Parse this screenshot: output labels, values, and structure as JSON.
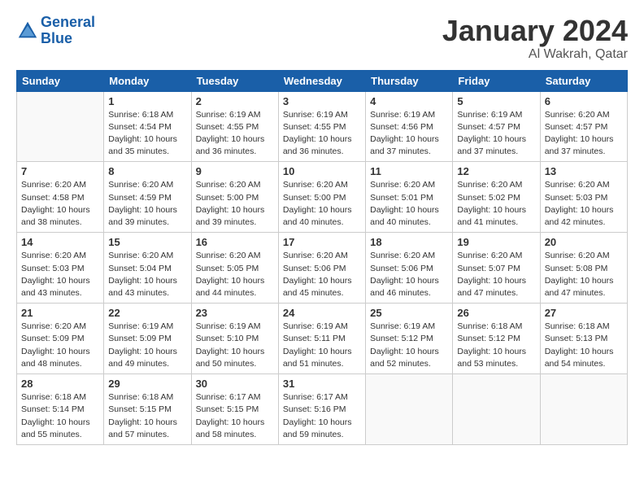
{
  "header": {
    "logo_line1": "General",
    "logo_line2": "Blue",
    "month": "January 2024",
    "location": "Al Wakrah, Qatar"
  },
  "days_of_week": [
    "Sunday",
    "Monday",
    "Tuesday",
    "Wednesday",
    "Thursday",
    "Friday",
    "Saturday"
  ],
  "weeks": [
    [
      {
        "day": "",
        "empty": true
      },
      {
        "day": "1",
        "sunrise": "6:18 AM",
        "sunset": "4:54 PM",
        "daylight": "10 hours and 35 minutes."
      },
      {
        "day": "2",
        "sunrise": "6:19 AM",
        "sunset": "4:55 PM",
        "daylight": "10 hours and 36 minutes."
      },
      {
        "day": "3",
        "sunrise": "6:19 AM",
        "sunset": "4:55 PM",
        "daylight": "10 hours and 36 minutes."
      },
      {
        "day": "4",
        "sunrise": "6:19 AM",
        "sunset": "4:56 PM",
        "daylight": "10 hours and 37 minutes."
      },
      {
        "day": "5",
        "sunrise": "6:19 AM",
        "sunset": "4:57 PM",
        "daylight": "10 hours and 37 minutes."
      },
      {
        "day": "6",
        "sunrise": "6:20 AM",
        "sunset": "4:57 PM",
        "daylight": "10 hours and 37 minutes."
      }
    ],
    [
      {
        "day": "7",
        "sunrise": "6:20 AM",
        "sunset": "4:58 PM",
        "daylight": "10 hours and 38 minutes."
      },
      {
        "day": "8",
        "sunrise": "6:20 AM",
        "sunset": "4:59 PM",
        "daylight": "10 hours and 39 minutes."
      },
      {
        "day": "9",
        "sunrise": "6:20 AM",
        "sunset": "5:00 PM",
        "daylight": "10 hours and 39 minutes."
      },
      {
        "day": "10",
        "sunrise": "6:20 AM",
        "sunset": "5:00 PM",
        "daylight": "10 hours and 40 minutes."
      },
      {
        "day": "11",
        "sunrise": "6:20 AM",
        "sunset": "5:01 PM",
        "daylight": "10 hours and 40 minutes."
      },
      {
        "day": "12",
        "sunrise": "6:20 AM",
        "sunset": "5:02 PM",
        "daylight": "10 hours and 41 minutes."
      },
      {
        "day": "13",
        "sunrise": "6:20 AM",
        "sunset": "5:03 PM",
        "daylight": "10 hours and 42 minutes."
      }
    ],
    [
      {
        "day": "14",
        "sunrise": "6:20 AM",
        "sunset": "5:03 PM",
        "daylight": "10 hours and 43 minutes."
      },
      {
        "day": "15",
        "sunrise": "6:20 AM",
        "sunset": "5:04 PM",
        "daylight": "10 hours and 43 minutes."
      },
      {
        "day": "16",
        "sunrise": "6:20 AM",
        "sunset": "5:05 PM",
        "daylight": "10 hours and 44 minutes."
      },
      {
        "day": "17",
        "sunrise": "6:20 AM",
        "sunset": "5:06 PM",
        "daylight": "10 hours and 45 minutes."
      },
      {
        "day": "18",
        "sunrise": "6:20 AM",
        "sunset": "5:06 PM",
        "daylight": "10 hours and 46 minutes."
      },
      {
        "day": "19",
        "sunrise": "6:20 AM",
        "sunset": "5:07 PM",
        "daylight": "10 hours and 47 minutes."
      },
      {
        "day": "20",
        "sunrise": "6:20 AM",
        "sunset": "5:08 PM",
        "daylight": "10 hours and 47 minutes."
      }
    ],
    [
      {
        "day": "21",
        "sunrise": "6:20 AM",
        "sunset": "5:09 PM",
        "daylight": "10 hours and 48 minutes."
      },
      {
        "day": "22",
        "sunrise": "6:19 AM",
        "sunset": "5:09 PM",
        "daylight": "10 hours and 49 minutes."
      },
      {
        "day": "23",
        "sunrise": "6:19 AM",
        "sunset": "5:10 PM",
        "daylight": "10 hours and 50 minutes."
      },
      {
        "day": "24",
        "sunrise": "6:19 AM",
        "sunset": "5:11 PM",
        "daylight": "10 hours and 51 minutes."
      },
      {
        "day": "25",
        "sunrise": "6:19 AM",
        "sunset": "5:12 PM",
        "daylight": "10 hours and 52 minutes."
      },
      {
        "day": "26",
        "sunrise": "6:18 AM",
        "sunset": "5:12 PM",
        "daylight": "10 hours and 53 minutes."
      },
      {
        "day": "27",
        "sunrise": "6:18 AM",
        "sunset": "5:13 PM",
        "daylight": "10 hours and 54 minutes."
      }
    ],
    [
      {
        "day": "28",
        "sunrise": "6:18 AM",
        "sunset": "5:14 PM",
        "daylight": "10 hours and 55 minutes."
      },
      {
        "day": "29",
        "sunrise": "6:18 AM",
        "sunset": "5:15 PM",
        "daylight": "10 hours and 57 minutes."
      },
      {
        "day": "30",
        "sunrise": "6:17 AM",
        "sunset": "5:15 PM",
        "daylight": "10 hours and 58 minutes."
      },
      {
        "day": "31",
        "sunrise": "6:17 AM",
        "sunset": "5:16 PM",
        "daylight": "10 hours and 59 minutes."
      },
      {
        "day": "",
        "empty": true
      },
      {
        "day": "",
        "empty": true
      },
      {
        "day": "",
        "empty": true
      }
    ]
  ]
}
